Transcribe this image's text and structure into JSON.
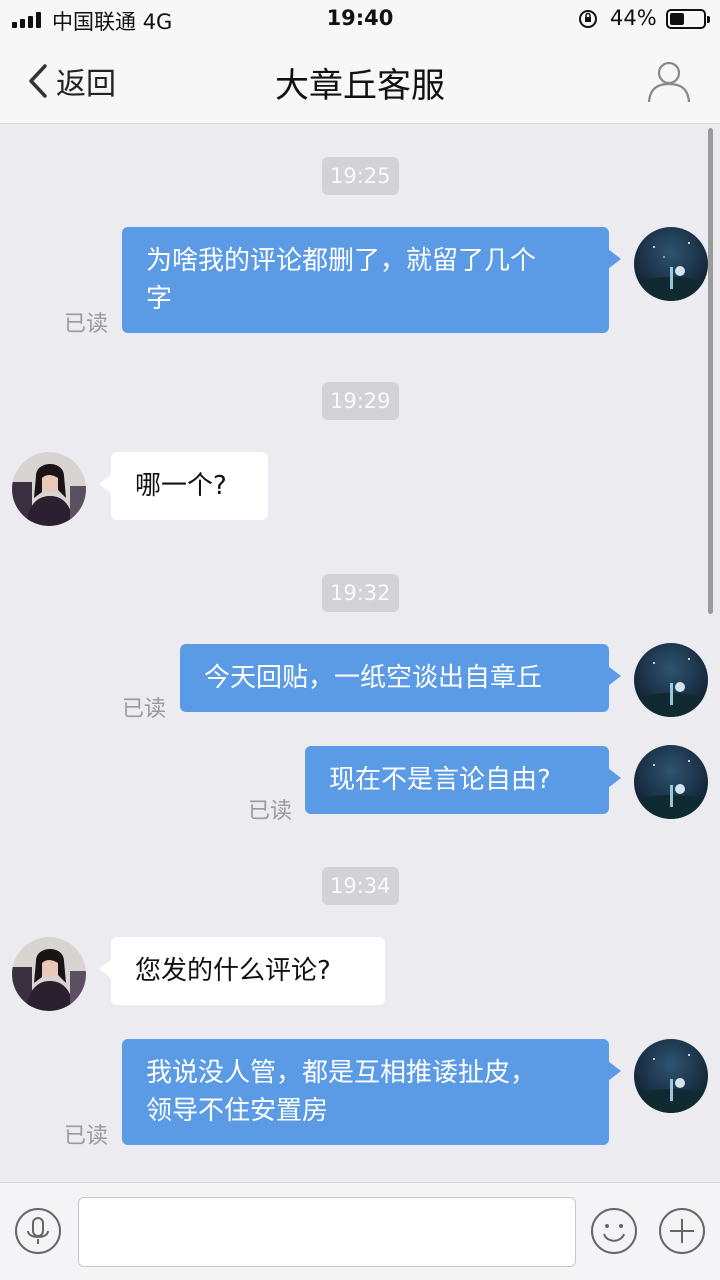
{
  "status_bar": {
    "carrier": "中国联通",
    "network": "4G",
    "time": "19:40",
    "battery_percent": "44%",
    "battery_level": 0.44
  },
  "nav": {
    "back_label": "返回",
    "title": "大章丘客服",
    "icons": {
      "back": "chevron-left-icon",
      "profile": "person-icon"
    }
  },
  "chat": {
    "timestamps": [
      "19:25",
      "19:29",
      "19:32",
      "19:34"
    ],
    "messages": [
      {
        "sender": "me",
        "text_lines": [
          "为啥我的评论都删了，就留了几个",
          "字"
        ],
        "status": "已读"
      },
      {
        "sender": "them",
        "text": "哪一个?"
      },
      {
        "sender": "me",
        "text": "今天回贴，一纸空谈出自章丘",
        "status": "已读"
      },
      {
        "sender": "me",
        "text": "现在不是言论自由?",
        "status": "已读"
      },
      {
        "sender": "them",
        "text": "您发的什么评论?"
      },
      {
        "sender": "me",
        "text_lines": [
          "我说没人管，都是互相推诿扯皮，",
          "领导不住安置房"
        ],
        "status": "已读"
      }
    ]
  },
  "input_bar": {
    "value": "",
    "icons": {
      "voice": "microphone-icon",
      "emoji": "smiley-icon",
      "more": "plus-icon"
    }
  },
  "colors": {
    "my_bubble": "#5b9be6",
    "their_bubble": "#ffffff",
    "background": "#ebebf0",
    "timestamp_pill": "#d2d2d7"
  }
}
